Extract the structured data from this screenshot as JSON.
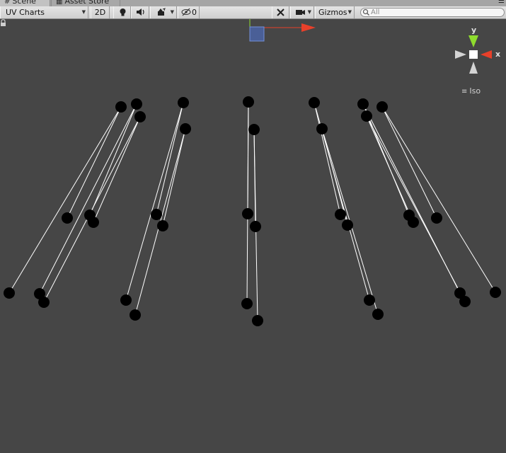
{
  "tabs": [
    {
      "label": "Scene",
      "icon": "hash-icon",
      "active": true
    },
    {
      "label": "Asset Store",
      "icon": "cart-icon",
      "active": false
    }
  ],
  "toolbar": {
    "draw_mode": "UV Charts",
    "mode_2d": "2D",
    "effects_count": "0",
    "gizmos_label": "Gizmos",
    "search_placeholder": "All"
  },
  "gizmo": {
    "y_label": "y",
    "x_label": "x",
    "projection_label": "Iso"
  },
  "colors": {
    "background": "#464646",
    "node": "#000000",
    "edge": "#ffffff",
    "axis_x": "#e8402a",
    "axis_y": "#8fdc2e"
  }
}
